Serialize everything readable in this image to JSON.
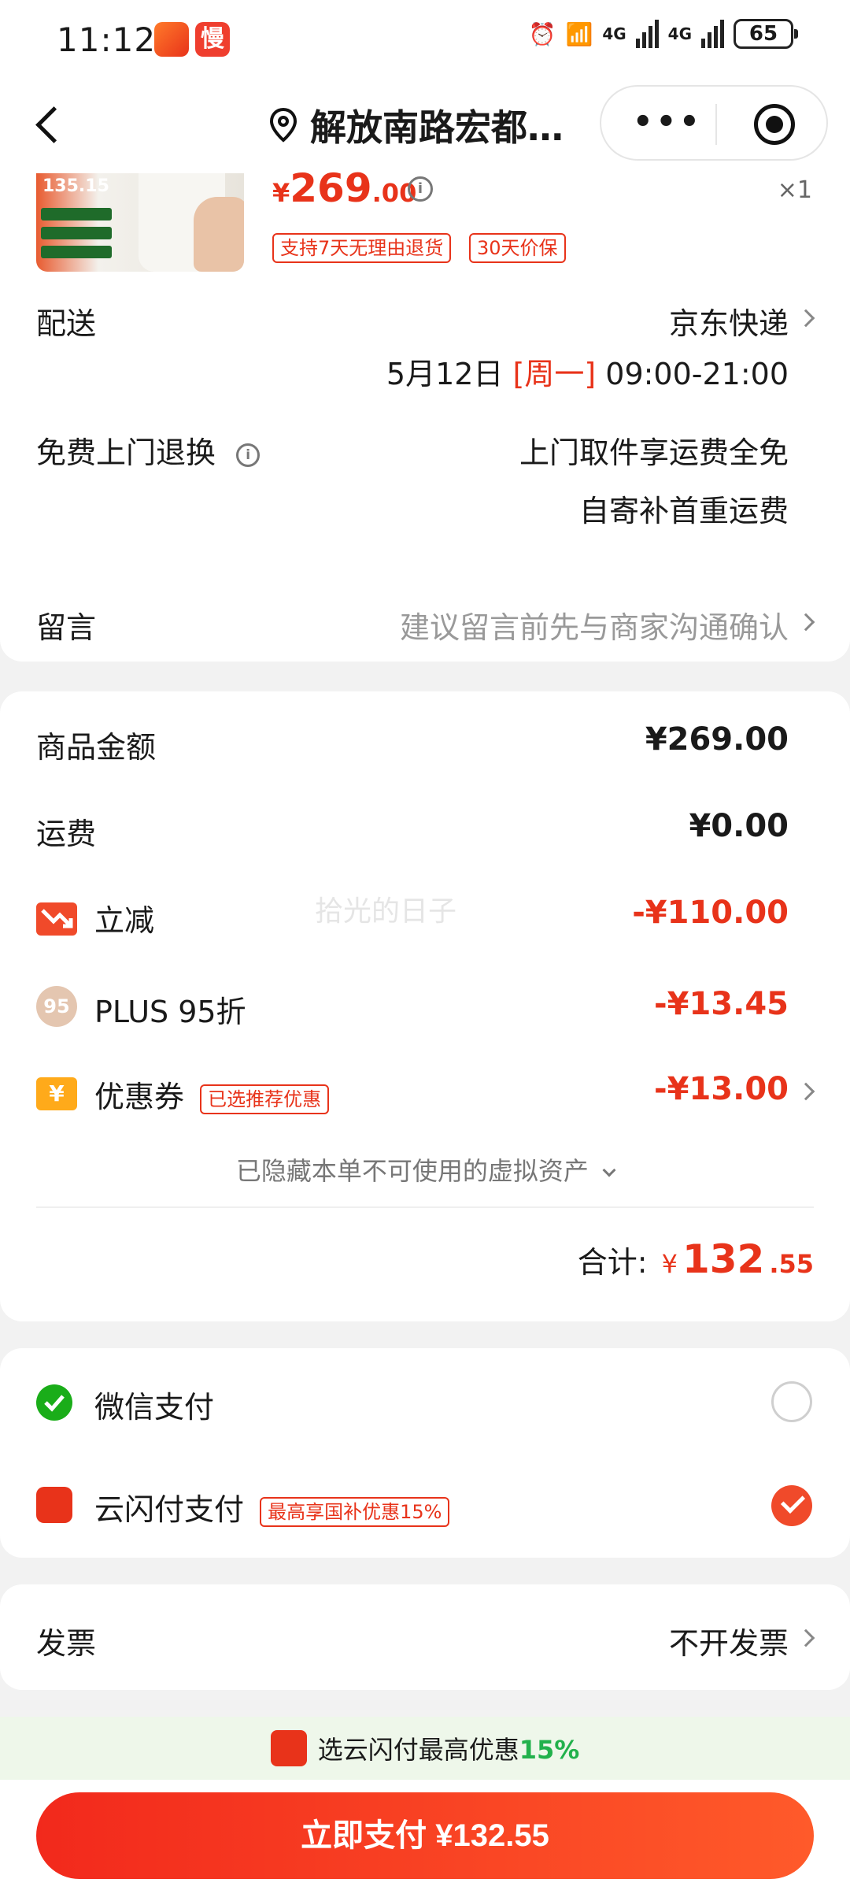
{
  "status_bar": {
    "time": "11:12",
    "badge_text": "慢",
    "network1": "4G",
    "network2": "4G",
    "battery": "65"
  },
  "nav": {
    "location": "解放南路宏都…"
  },
  "product": {
    "thumb_price": "135.15",
    "price_symbol": "¥",
    "price_int": "269",
    "price_dec": ".00",
    "quantity": "×1",
    "tags": [
      "支持7天无理由退货",
      "30天价保"
    ]
  },
  "delivery": {
    "label": "配送",
    "value": "京东快递",
    "date": "5月12日",
    "weekday": "[周一]",
    "time": "09:00-21:00"
  },
  "return_service": {
    "label": "免费上门退换",
    "line1": "上门取件享运费全免",
    "line2": "自寄补首重运费"
  },
  "message": {
    "label": "留言",
    "placeholder": "建议留言前先与商家沟通确认"
  },
  "amounts": {
    "goods_label": "商品金额",
    "goods_value": "¥269.00",
    "shipping_label": "运费",
    "shipping_value": "¥0.00",
    "instant_label": "立减",
    "instant_value": "-¥110.00",
    "plus_icon": "95",
    "plus_label": "PLUS 95折",
    "plus_value": "-¥13.45",
    "coupon_icon": "¥",
    "coupon_label": "优惠券",
    "coupon_tag": "已选推荐优惠",
    "coupon_value": "-¥13.00",
    "hidden_note": "已隐藏本单不可使用的虚拟资产",
    "total_label": "合计:",
    "total_symbol": "¥",
    "total_int": "132",
    "total_dec": ".55"
  },
  "watermark": "拾光的日子",
  "payment": {
    "wechat_label": "微信支付",
    "unionpay_label": "云闪付支付",
    "unionpay_tag": "最高享国补优惠15%"
  },
  "invoice": {
    "label": "发票",
    "value": "不开发票"
  },
  "promo": {
    "text": "选云闪付最高优惠",
    "percent": "15%"
  },
  "pay_button": "立即支付 ¥132.55",
  "colors": {
    "accent_red": "#e8331a",
    "promo_green": "#22b14c",
    "wechat_green": "#1aad19"
  }
}
